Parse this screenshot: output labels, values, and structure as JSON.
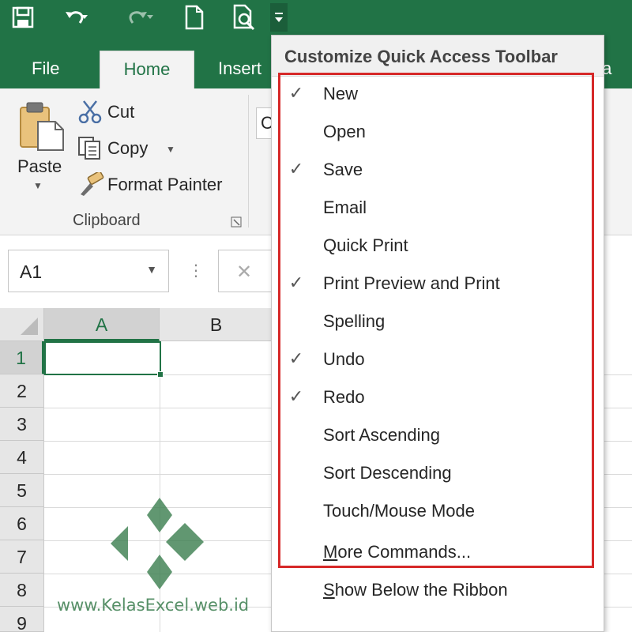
{
  "colors": {
    "accent": "#217346",
    "highlight_border": "#d62828",
    "ribbon_bg": "#f3f3f3"
  },
  "qat": {
    "icons": [
      "save-icon",
      "undo-icon",
      "redo-icon",
      "new-document-icon",
      "print-preview-icon",
      "customize-toolbar-dropdown-icon"
    ]
  },
  "tabs": {
    "file": "File",
    "home": "Home",
    "insert": "Insert",
    "data_partial": "ta"
  },
  "ribbon": {
    "paste": "Paste",
    "cut": "Cut",
    "copy": "Copy",
    "format_painter": "Format Painter",
    "group_label": "Clipboard",
    "font_partial": "C"
  },
  "formula_bar": {
    "name_box_value": "A1",
    "more_dots": "⋮",
    "cancel_symbol": "✕"
  },
  "grid": {
    "columns": [
      "A",
      "B"
    ],
    "rows": [
      "1",
      "2",
      "3",
      "4",
      "5",
      "6",
      "7",
      "8",
      "9"
    ]
  },
  "menu": {
    "title": "Customize Quick Access Toolbar",
    "items": [
      {
        "label": "New",
        "checked": true
      },
      {
        "label": "Open",
        "checked": false
      },
      {
        "label": "Save",
        "checked": true
      },
      {
        "label": "Email",
        "checked": false
      },
      {
        "label": "Quick Print",
        "checked": false
      },
      {
        "label": "Print Preview and Print",
        "checked": true
      },
      {
        "label": "Spelling",
        "checked": false
      },
      {
        "label": "Undo",
        "checked": true
      },
      {
        "label": "Redo",
        "checked": true
      },
      {
        "label": "Sort Ascending",
        "checked": false
      },
      {
        "label": "Sort Descending",
        "checked": false
      },
      {
        "label": "Touch/Mouse Mode",
        "checked": false
      }
    ],
    "more_commands": {
      "accel": "M",
      "rest": "ore Commands..."
    },
    "show_below": {
      "accel": "S",
      "rest": "how Below the Ribbon"
    }
  },
  "watermark": {
    "text": "www.KelasExcel.web.id"
  }
}
